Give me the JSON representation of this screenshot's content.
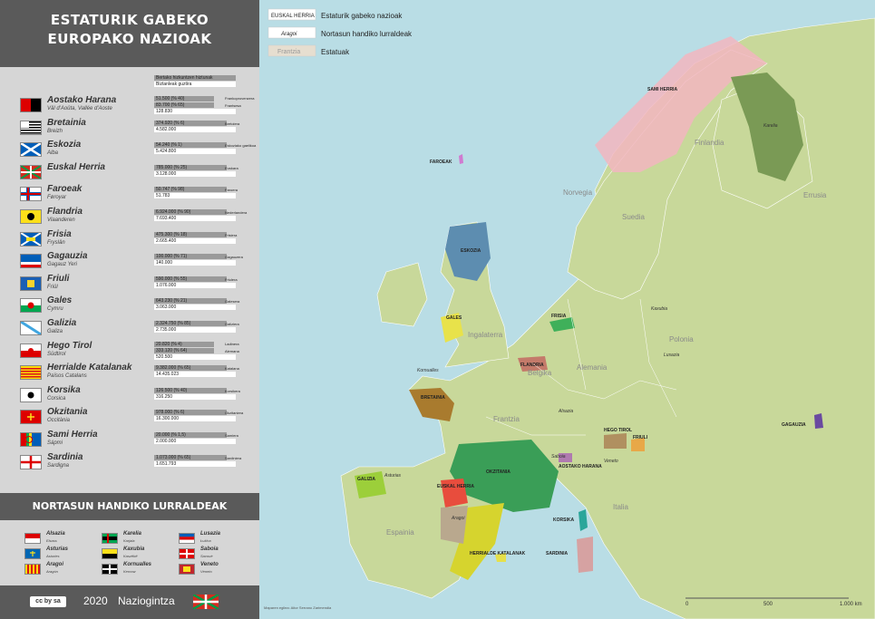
{
  "panel": {
    "title_line1": "ESTATURIK GABEKO",
    "title_line2": "EUROPAKO NAZIOAK",
    "key": {
      "bar1": "Bertako hizkuntzen hiztunak",
      "bar2": "Biztanleak guztira"
    },
    "nations": [
      {
        "name": "Aostako Harana",
        "sub": "Vâl d'Aoûta, Vallée d'Aoste",
        "speakers": "51.500 (% 40)",
        "speakers2": "83.700 (% 65)",
        "pop": "128.830",
        "tag1": "Frankoprovenzera",
        "tag2": "Frantsesa",
        "flag": "aosta"
      },
      {
        "name": "Bretainia",
        "sub": "Breizh",
        "speakers": "374.920 (% 6)",
        "pop": "4.582.000",
        "tag1": "Bretoiera",
        "flag": "brittany"
      },
      {
        "name": "Eskozia",
        "sub": "Alba",
        "speakers": "54.240 (% 1)",
        "pop": "5.424.800",
        "tag1": "Eskoziako gaelikoa",
        "flag": "scotland"
      },
      {
        "name": "Euskal Herria",
        "sub": "",
        "speakers": "785.000 (% 25)",
        "pop": "3.128.000",
        "tag1": "Euskara",
        "flag": "ikurrina"
      },
      {
        "name": "Faroeak",
        "sub": "Føroyar",
        "speakers": "50.747 (% 98)",
        "pop": "51.783",
        "tag1": "Faroera",
        "flag": "faroe"
      },
      {
        "name": "Flandria",
        "sub": "Vlaanderen",
        "speakers": "6.924.000 (% 90)",
        "pop": "7.693.400",
        "tag1": "Nederlandera",
        "flag": "flanders"
      },
      {
        "name": "Frisia",
        "sub": "Fryslân",
        "speakers": "475.300 (% 18)",
        "pop": "2.665.400",
        "tag1": "Frisiera",
        "flag": "frisia"
      },
      {
        "name": "Gagauzia",
        "sub": "Gagauz Yeri",
        "speakers": "100.000 (% 71)",
        "pop": "140.000",
        "tag1": "Gagauzera",
        "flag": "gagauzia"
      },
      {
        "name": "Friuli",
        "sub": "Friûl",
        "speakers": "590.000 (% 55)",
        "pop": "1.076.000",
        "tag1": "Friulera",
        "flag": "friuli"
      },
      {
        "name": "Gales",
        "sub": "Cymru",
        "speakers": "643.230 (% 21)",
        "pop": "3.063.000",
        "tag1": "Galesera",
        "flag": "wales"
      },
      {
        "name": "Galizia",
        "sub": "Galiza",
        "speakers": "2.324.750 (% 85)",
        "pop": "2.735.000",
        "tag1": "Galiziera",
        "flag": "galicia"
      },
      {
        "name": "Hego Tirol",
        "sub": "Südtirol",
        "speakers": "20.820 (% 4)",
        "speakers2": "333.120 (% 64)",
        "pop": "520.500",
        "tag1": "Ladinera",
        "tag2": "Alemana",
        "flag": "tyrol"
      },
      {
        "name": "Herrialde Katalanak",
        "sub": "Països Catalans",
        "speakers": "9.382.000 (% 65)",
        "pop": "14.435.023",
        "tag1": "Katalana",
        "flag": "catalonia"
      },
      {
        "name": "Korsika",
        "sub": "Corsica",
        "speakers": "126.500 (% 40)",
        "pop": "316.250",
        "tag1": "Korsikera",
        "flag": "corsica"
      },
      {
        "name": "Okzitania",
        "sub": "Occitània",
        "speakers": "978.000 (% 6)",
        "pop": "16.300.000",
        "tag1": "Okzitaniera",
        "flag": "occitania"
      },
      {
        "name": "Sami Herria",
        "sub": "Sápmi",
        "speakers": "20.000 (% 1,5)",
        "pop": "2.000.000",
        "tag1": "Samiera",
        "flag": "sapmi"
      },
      {
        "name": "Sardinia",
        "sub": "Sardigna",
        "speakers": "1.073.000 (% 65)",
        "pop": "1.651.793",
        "tag1": "Sardiniera",
        "flag": "sardinia"
      }
    ],
    "section2_title": "NORTASUN HANDIKO LURRALDEAK",
    "regions": [
      {
        "name": "Alsazia",
        "sub": "Elsass",
        "flag": "alsace"
      },
      {
        "name": "Karelia",
        "sub": "Karjala",
        "flag": "karelia"
      },
      {
        "name": "Lusazia",
        "sub": "Łužica",
        "flag": "lusatia"
      },
      {
        "name": "Asturias",
        "sub": "Asturies",
        "flag": "asturias"
      },
      {
        "name": "Kaxubia",
        "sub": "Kaszëbë",
        "flag": "kashubia"
      },
      {
        "name": "Saboia",
        "sub": "Savouè",
        "flag": "savoy"
      },
      {
        "name": "Aragoi",
        "sub": "Aragón",
        "flag": "aragon"
      },
      {
        "name": "Kornualles",
        "sub": "Kernow",
        "flag": "cornwall"
      },
      {
        "name": "Veneto",
        "sub": "Vèneto",
        "flag": "veneto"
      }
    ],
    "footer": {
      "cc": "cc by sa",
      "year": "2020",
      "brand": "Naziogintza"
    }
  },
  "map_legend": [
    {
      "sample": "EUSKAL HERRIA",
      "text": "Estaturik gabeko nazioak"
    },
    {
      "sample": "Aragoi",
      "text": "Nortasun handiko lurraldeak"
    },
    {
      "sample": "Frantzia",
      "text": "Estatuak"
    }
  ],
  "map_labels": {
    "states": [
      "Norvegia",
      "Suedia",
      "Finlandia",
      "Errusia",
      "Ingalaterra",
      "Alemania",
      "Polonia",
      "Frantzia",
      "Espainia",
      "Italia",
      "Belgika"
    ],
    "nations": [
      "SAMI HERRIA",
      "FAROEAK",
      "ESKOZIA",
      "GALES",
      "FRISIA",
      "FLANDRIA",
      "BRETAINIA",
      "HEGO TIROL",
      "FRIULI",
      "AOSTAKO HARANA",
      "OKZITANIA",
      "GALIZIA",
      "EUSKAL HERRIA",
      "KORSIKA",
      "SARDINIA",
      "GAGAUZIA",
      "HERRIALDE KATALANAK"
    ],
    "regions": [
      "Karelia",
      "Kornualles",
      "Aragoi",
      "Asturias",
      "Kaxubia",
      "Lusazia",
      "Alsazia",
      "Saboia",
      "Veneto"
    ]
  },
  "scale": {
    "zero": "0",
    "mid": "500",
    "end": "1.000 km"
  },
  "credit": "Maparen egilea: Aitor Serrano Zarimendia",
  "colors": {
    "sea": "#b9dde5",
    "land": "#c8d89a",
    "panel": "#d6d6d6",
    "dark": "#5a5a5a"
  }
}
